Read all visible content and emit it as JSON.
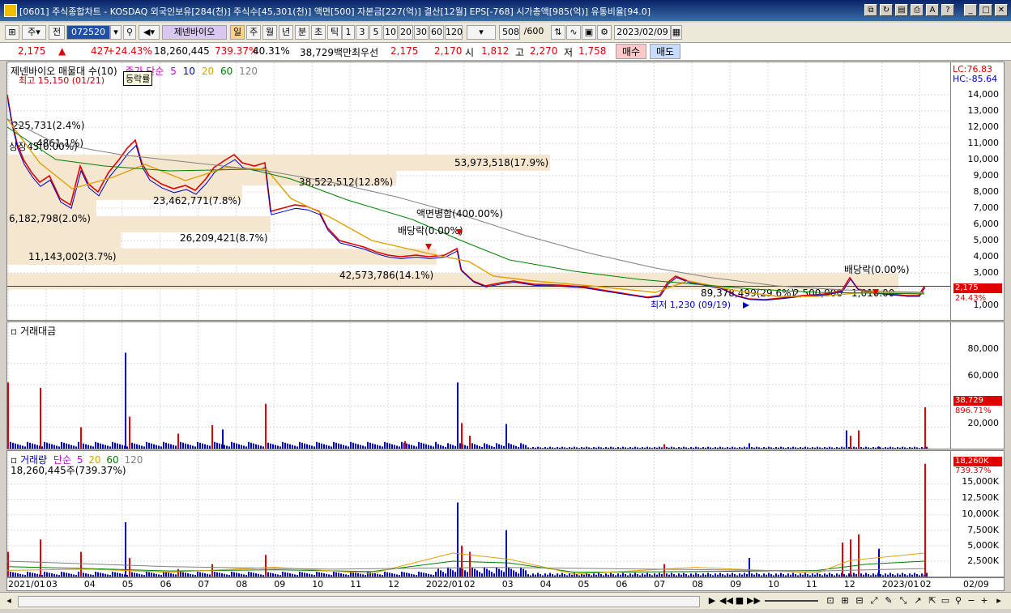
{
  "window": {
    "title": "[0601] 주식종합차트 - KOSDAQ 외국인보유[284(천)] 주식수[45,301(천)] 액면[500] 자본금[227(억)] 결산[12월] EPS[-768] 시가총액[985(억)] 유통비율[94.0]"
  },
  "toolbar": {
    "type_select": "주",
    "prev_label": "전",
    "code": "072520",
    "name_button": "제넨바이오",
    "period_buttons": [
      "일",
      "주",
      "월",
      "년",
      "분",
      "초",
      "틱"
    ],
    "interval_buttons": [
      "1",
      "3",
      "5",
      "10",
      "20",
      "30",
      "60",
      "120"
    ],
    "count": "508",
    "count_total": "/600",
    "date": "2023/02/09"
  },
  "quote": {
    "price": "2,175",
    "change": "427",
    "change_pct": "+24.43%",
    "volume": "18,260,445",
    "volume_ratio": "739.37%",
    "turnover": "40.31%",
    "amount": "38,729백만",
    "bid_label": "최우선",
    "ask": "2,175",
    "bid": "2,170",
    "open_label": "시",
    "open": "1,812",
    "high_label": "고",
    "high": "2,270",
    "low_label": "저",
    "low": "1,758",
    "buy_label": "매수",
    "sell_label": "매도"
  },
  "price_pane": {
    "legend_title": "제넨바이오 매물대 수(10)",
    "legend_ma": "종가 단순",
    "ma_periods": [
      "5",
      "10",
      "20",
      "60",
      "120"
    ],
    "ma_colors": [
      "#c000c0",
      "#0000c0",
      "#e0a000",
      "#008000",
      "#808080"
    ],
    "popup_label": "등락률",
    "high_note": "최고 15,150 (01/21)",
    "low_note": "최저 1,230 (09/19)",
    "lc": "LC:76.83",
    "hc": "HC:-85.64",
    "current_tag": "2,175",
    "current_pct": "24.43%",
    "ticks": [
      "14,000",
      "13,000",
      "12,000",
      "11,000",
      "10,000",
      "9,000",
      "8,000",
      "7,000",
      "6,000",
      "5,000",
      "4,000",
      "3,000",
      "2,000",
      "1,000"
    ],
    "volume_profile": [
      "53,973,518(17.9%)",
      "38,522,512(12.8%)",
      "23,462,771(7.8%)",
      "6,182,798(2.0%)",
      "26,209,421(8.7%)",
      "11,143,002(3.7%)",
      "42,573,786(14.1%)",
      "89,378,499(29.6%)",
      "2,500,000",
      "1,010.00",
      "225,731(2.4%)",
      "상장45(0.00%)",
      "4861.1%)"
    ],
    "events": [
      "액면병합(400.00%)",
      "배당락(0.00%)",
      "배당락(0.00%)"
    ]
  },
  "amount_pane": {
    "title": "거래대금",
    "ticks": [
      "80,000",
      "60,000",
      "40,000",
      "20,000"
    ],
    "current_tag": "38,729",
    "current_pct": "896.71%"
  },
  "volume_pane": {
    "title": "거래량",
    "legend_ma": "단순",
    "ma_periods": [
      "5",
      "20",
      "60",
      "120"
    ],
    "current_label": "18,260,445주(739.37%)",
    "ticks": [
      "15,000K",
      "12,500K",
      "10,000K",
      "7,500K",
      "5,000K",
      "2,500K"
    ],
    "current_tag": "18,260K",
    "current_pct": "739.37%"
  },
  "date_axis": [
    "2021/01",
    "03",
    "04",
    "05",
    "06",
    "07",
    "08",
    "09",
    "10",
    "11",
    "12",
    "2022/01",
    "02",
    "03",
    "04",
    "05",
    "06",
    "07",
    "08",
    "09",
    "10",
    "11",
    "12",
    "2023/01",
    "02",
    "02/09"
  ],
  "chart_data": {
    "type": "line",
    "title": "제넨바이오",
    "x": [
      "2021/01",
      "2021/03",
      "2021/04",
      "2021/05",
      "2021/06",
      "2021/07",
      "2021/08",
      "2021/09",
      "2021/10",
      "2021/11",
      "2021/12",
      "2022/01",
      "2022/02",
      "2022/03",
      "2022/04",
      "2022/05",
      "2022/06",
      "2022/07",
      "2022/08",
      "2022/09",
      "2022/10",
      "2022/11",
      "2022/12",
      "2023/01",
      "2023/02"
    ],
    "series": [
      {
        "name": "종가",
        "values": [
          14000,
          7300,
          8200,
          10500,
          8300,
          9800,
          9500,
          7000,
          5500,
          4200,
          4000,
          4200,
          2600,
          2700,
          2500,
          2200,
          2000,
          1500,
          2700,
          2000,
          1400,
          1600,
          1700,
          1900,
          2175
        ]
      }
    ],
    "ylim": [
      1000,
      14500
    ]
  }
}
